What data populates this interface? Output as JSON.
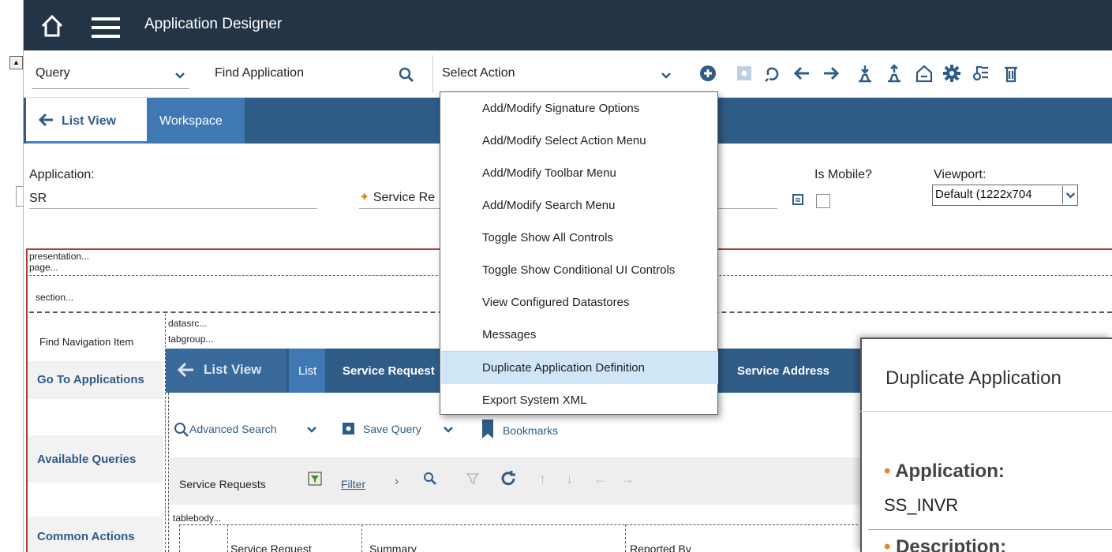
{
  "header": {
    "title": "Application Designer"
  },
  "toolbar": {
    "query_label": "Query",
    "find_label": "Find Application",
    "select_action_label": "Select Action"
  },
  "tabs": {
    "list_view": "List View",
    "workspace": "Workspace"
  },
  "form": {
    "application_label": "Application:",
    "application_value": "SR",
    "service_label": "Service Re",
    "is_mobile_label": "Is Mobile?",
    "viewport_label": "Viewport:",
    "viewport_value": "Default (1222x704"
  },
  "canvas": {
    "presentation": "presentation...",
    "page": "page...",
    "section": "section...",
    "datasrc": "datasrc...",
    "tabgroup": "tabgroup...",
    "tablebody": "tablebody...",
    "find_nav": "Find Navigation Item",
    "go_to_apps": "Go To Applications",
    "available_queries": "Available Queries",
    "common_actions": "Common Actions"
  },
  "inner": {
    "list_view": "List View",
    "list": "List",
    "service_request": "Service Request",
    "service_address": "Service Address",
    "advanced_search": "Advanced Search",
    "save_query": "Save Query",
    "bookmarks": "Bookmarks",
    "grid_title": "Service Requests",
    "filter": "Filter",
    "col_service_request": "Service Request",
    "col_summary": "Summary",
    "col_reported_by": "Reported By"
  },
  "action_menu": {
    "items": [
      "Add/Modify Signature Options",
      "Add/Modify Select Action Menu",
      "Add/Modify Toolbar Menu",
      "Add/Modify Search Menu",
      "Toggle Show All Controls",
      "Toggle Show Conditional UI Controls",
      "View Configured Datastores",
      "Messages",
      "Duplicate Application Definition",
      "Export System XML"
    ],
    "highlighted_index": 8
  },
  "dialog": {
    "title": "Duplicate Application",
    "application_label": "Application:",
    "application_value": "SS_INVR",
    "description_label": "Description:"
  },
  "colors": {
    "header_bg": "#243447",
    "tab_bg": "#2f5b87",
    "active_tab": "#3f78b3",
    "menu_highlight": "#cfe6f7",
    "required": "#e08a2a"
  }
}
